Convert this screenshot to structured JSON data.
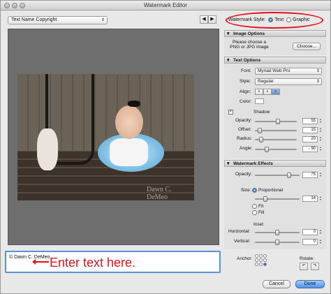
{
  "window": {
    "title": "Watermark Editor"
  },
  "preset": {
    "value": "Text Name Copyright"
  },
  "nav": {
    "prev": "◀",
    "next": "▶"
  },
  "style_selector": {
    "label": "Watermark Style:",
    "text": "Text",
    "graphic": "Graphic"
  },
  "preview": {
    "watermark_text": "Dawn C. DeMeo"
  },
  "text_entry": {
    "value": "© Dawn C. DeMeo"
  },
  "annotation": {
    "text": "Enter text here.",
    "color": "#e0111b"
  },
  "image_options": {
    "header": "Image Options",
    "hint_line1": "Please choose a",
    "hint_line2": "PNG or JPG image",
    "choose_button": "Choose..."
  },
  "text_options": {
    "header": "Text Options",
    "font_label": "Font:",
    "font_value": "Myriad Web Pro",
    "style_label": "Style:",
    "style_value": "Regular",
    "align_label": "Align:",
    "color_label": "Color:"
  },
  "shadow": {
    "label": "Shadow",
    "checked": "✓",
    "opacity_label": "Opacity:",
    "opacity_value": "55",
    "offset_label": "Offset:",
    "offset_value": "15",
    "radius_label": "Radius:",
    "radius_value": "20",
    "angle_label": "Angle:",
    "angle_value": "- 90"
  },
  "watermark_effects": {
    "header": "Watermark Effects",
    "opacity_label": "Opacity:",
    "opacity_value": "75",
    "size_label": "Size:",
    "proportional": "Proportional",
    "size_value": "14",
    "fit": "Fit",
    "fill": "Fill"
  },
  "inset": {
    "label": "Inset",
    "horizontal_label": "Horizontal:",
    "horizontal_value": "0",
    "vertical_label": "Vertical:",
    "vertical_value": "0"
  },
  "bottom": {
    "anchor_label": "Anchor:",
    "rotate_label": "Rotate:",
    "rotate_left": "↶",
    "rotate_right": "↷",
    "cancel": "Cancel",
    "done": "Done"
  },
  "accent": "#2d6fd1"
}
